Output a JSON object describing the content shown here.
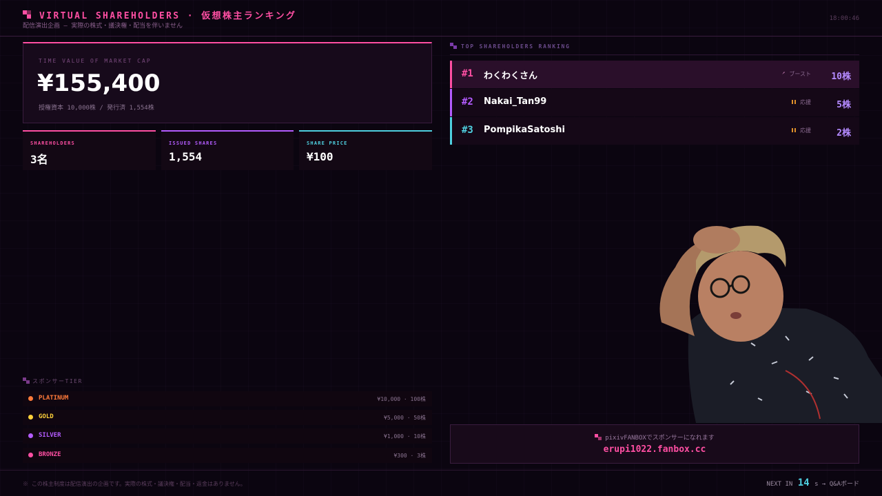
{
  "header": {
    "title": "VIRTUAL SHAREHOLDERS · 仮想株主ランキング",
    "subtitle": "配信演出企画 — 実際の株式・議決権・配当を伴いません",
    "clock": "18:00:46"
  },
  "market_cap": {
    "label": "TIME VALUE OF MARKET CAP",
    "value": "¥155,400",
    "sub": "授権資本 10,000株 / 発行済 1,554株"
  },
  "stats": [
    {
      "label": "SHAREHOLDERS",
      "value": "3名",
      "color": "#ff4fa3"
    },
    {
      "label": "ISSUED SHARES",
      "value": "1,554",
      "color": "#b45cff"
    },
    {
      "label": "SHARE PRICE",
      "value": "¥100",
      "color": "#4fd0e0"
    }
  ],
  "tiers": {
    "heading": "スポンサーTIER",
    "items": [
      {
        "name": "PLATINUM",
        "price": "¥10,000 · 100株",
        "color": "#ff7a3a"
      },
      {
        "name": "GOLD",
        "price": "¥5,000 · 50株",
        "color": "#ffd23a"
      },
      {
        "name": "SILVER",
        "price": "¥1,000 · 10株",
        "color": "#b45cff"
      },
      {
        "name": "BRONZE",
        "price": "¥300 · 3株",
        "color": "#ff4fa3"
      }
    ]
  },
  "ranking": {
    "heading": "TOP SHAREHOLDERS RANKING",
    "rows": [
      {
        "pos": "#1",
        "name": "わくわくさん",
        "badge": "ブースト",
        "badge_icon": "rocket-icon",
        "shares": "10株",
        "color": "#ff4fa3"
      },
      {
        "pos": "#2",
        "name": "Nakai_Tan99",
        "badge": "応援",
        "badge_icon": "cheer-icon",
        "shares": "5株",
        "color": "#b45cff"
      },
      {
        "pos": "#3",
        "name": "PompikaSatoshi",
        "badge": "応援",
        "badge_icon": "cheer-icon",
        "shares": "2株",
        "color": "#4fd0e0"
      }
    ]
  },
  "fanbox": {
    "line1": "pixivFANBOXでスポンサーになれます",
    "url": "erupi1022.fanbox.cc"
  },
  "footer": {
    "disclaimer": "※ この株主制度は配信演出の企画です。実際の株式・議決権・配当・返金はありません。",
    "next_prefix": "NEXT IN",
    "next_seconds": "14",
    "next_suffix": "s → Q&Aボード"
  }
}
